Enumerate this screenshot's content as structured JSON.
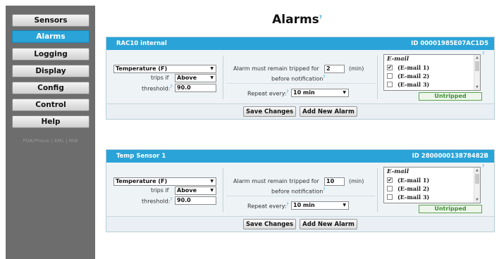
{
  "sidebar": {
    "items": [
      {
        "label": "Sensors",
        "active": false
      },
      {
        "label": "Alarms",
        "active": true
      },
      {
        "label": "Logging",
        "active": false
      },
      {
        "label": "Display",
        "active": false
      },
      {
        "label": "Config",
        "active": false
      },
      {
        "label": "Control",
        "active": false
      },
      {
        "label": "Help",
        "active": false
      }
    ],
    "footer_links": "PDA/Phone | XML | MIB"
  },
  "page": {
    "title": "Alarms",
    "help_mark": "?"
  },
  "alarms": [
    {
      "sensor_name": "RAC10 internal",
      "sensor_id": "ID 00001985E07AC1D5",
      "measure": "Temperature (F)",
      "trips_if_label": "trips if",
      "trips_if": "Above",
      "threshold_label": "threshold:",
      "threshold": "90.0",
      "tripped_for_label": "Alarm must remain tripped for",
      "tripped_for": "2",
      "tripped_for_unit": "(min)",
      "before_notification": "before notification",
      "repeat_label": "Repeat every:",
      "repeat": "10 min",
      "email_title": "E-mail",
      "emails": [
        {
          "label": "(E-mail 1)",
          "checked": true
        },
        {
          "label": "(E-mail 2)",
          "checked": false
        },
        {
          "label": "(E-mail 3)",
          "checked": false
        }
      ],
      "status": "Untripped",
      "save_label": "Save Changes",
      "add_label": "Add New Alarm"
    },
    {
      "sensor_name": "Temp Sensor 1",
      "sensor_id": "ID 280000013878482B",
      "measure": "Temperature (F)",
      "trips_if_label": "trips if",
      "trips_if": "Above",
      "threshold_label": "threshold:",
      "threshold": "90.0",
      "tripped_for_label": "Alarm must remain tripped for",
      "tripped_for": "10",
      "tripped_for_unit": "(min)",
      "before_notification": "before notification",
      "repeat_label": "Repeat every:",
      "repeat": "10 min",
      "email_title": "E-mail",
      "emails": [
        {
          "label": "(E-mail 1)",
          "checked": true
        },
        {
          "label": "(E-mail 2)",
          "checked": false
        },
        {
          "label": "(E-mail 3)",
          "checked": false
        }
      ],
      "status": "Untripped",
      "save_label": "Save Changes",
      "add_label": "Add New Alarm"
    }
  ],
  "icons": {
    "checkmark": "✔",
    "dropdown_arrow": "▼",
    "scroll_up": "▲",
    "scroll_down": "▼"
  },
  "colors": {
    "accent": "#2aa3d8",
    "sidebar_bg": "#6d6d6d",
    "status_green": "#3e8f33"
  }
}
